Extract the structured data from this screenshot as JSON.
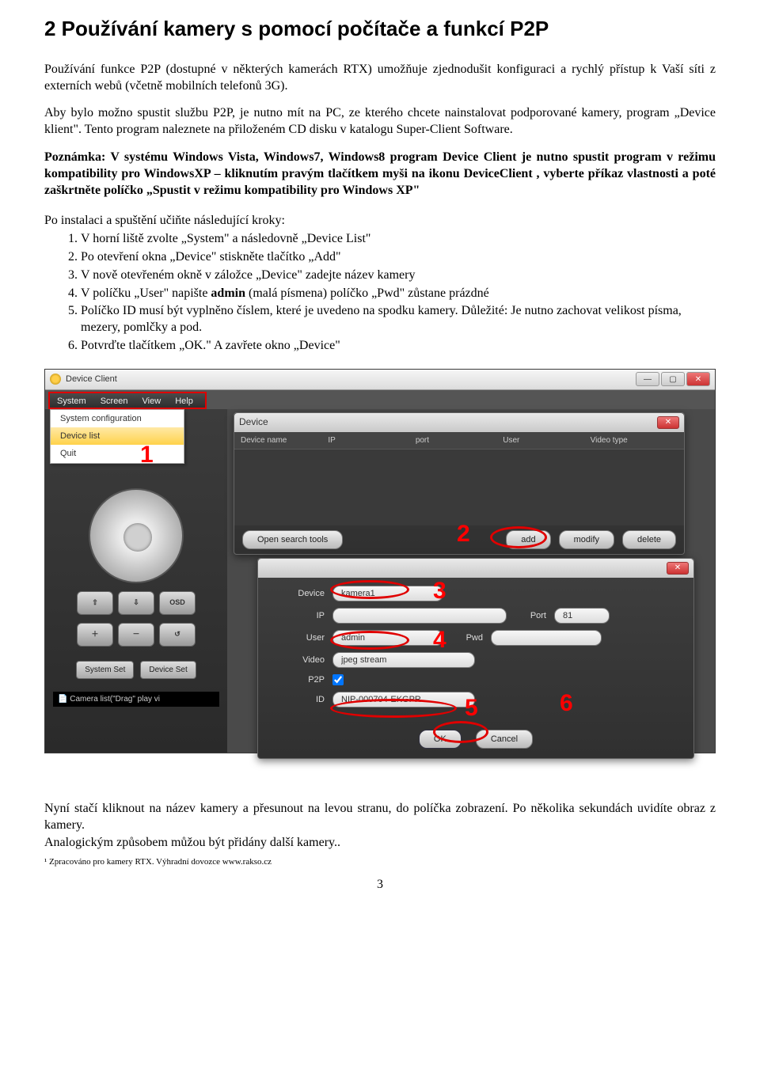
{
  "heading": "2 Používání kamery s pomocí počítače a funkcí P2P",
  "para1": "Používání funkce P2P (dostupné v některých kamerách RTX) umožňuje zjednodušit konfiguraci a rychlý přístup k Vaší síti z externích webů (včetně mobilních telefonů 3G).",
  "para2": "Aby bylo možno spustit službu P2P, je nutno mít na PC, ze kterého chcete nainstalovat podporované kamery, program „Device klient\". Tento program naleznete na přiloženém CD disku v katalogu Super-Client Software.",
  "note": "Poznámka: V systému Windows Vista, Windows7, Windows8 program Device Client je nutno spustit program v režimu kompatibility pro WindowsXP – kliknutím pravým tlačítkem myši na ikonu DeviceClient , vyberte příkaz vlastnosti a poté zaškrtněte políčko „Spustit v režimu kompatibility pro Windows XP\"",
  "steps_intro": "Po instalaci a spuštění učiňte následující kroky:",
  "steps": [
    "V horní liště zvolte „System\" a následovně „Device List\"",
    "Po otevření okna  „Device\" stiskněte tlačítko „Add\"",
    "V nově otevřeném okně v záložce „Device\" zadejte název kamery",
    "V políčku „User\" napište admin (malá písmena) políčko „Pwd\" zůstane prázdné",
    "Políčko ID musí být vyplněno číslem, které je uvedeno na spodku kamery. Důležité: Je nutno zachovat velikost písma, mezery, pomlčky a pod.",
    "Potvrďte tlačítkem „OK.\" A zavřete okno „Device\""
  ],
  "step4_bold": "admin",
  "screenshot": {
    "app_title": "Device Client",
    "menu": {
      "system": "System",
      "screen": "Screen",
      "view": "View",
      "help": "Help"
    },
    "dropdown": {
      "sysconfig": "System configuration",
      "devicelist": "Device list",
      "quit": "Quit"
    },
    "callouts": {
      "c1": "1",
      "c2": "2",
      "c3": "3",
      "c4": "4",
      "c5": "5",
      "c6": "6"
    },
    "sidebar": {
      "osd": "OSD",
      "system_set": "System Set",
      "device_set": "Device Set",
      "camlist": "Camera list(\"Drag\" play vi"
    },
    "dlg1": {
      "title": "Device",
      "cols": {
        "name": "Device name",
        "ip": "IP",
        "port": "port",
        "user": "User",
        "video": "Video type"
      },
      "open_tools": "Open search tools",
      "add": "add",
      "modify": "modify",
      "delete": "delete"
    },
    "dlg2": {
      "labels": {
        "device": "Device",
        "ip": "IP",
        "port": "Port",
        "user": "User",
        "pwd": "Pwd",
        "video": "Video",
        "p2p": "P2P",
        "id": "ID"
      },
      "values": {
        "device": "kamera1",
        "port": "81",
        "user": "admin",
        "video": "jpeg stream",
        "id": "NIP-000704-EKGPR"
      },
      "ok": "OK",
      "cancel": "Cancel"
    }
  },
  "footer1": "Nyní stačí kliknout na název kamery a přesunout na levou stranu, do políčka zobrazení. Po několika sekundách uvidíte obraz z kamery.",
  "footer2": "Analogickým způsobem můžou být přidány další kamery..",
  "footnote": "¹ Zpracováno pro kamery RTX. Výhradní dovozce www.rakso.cz",
  "pagenum": "3"
}
